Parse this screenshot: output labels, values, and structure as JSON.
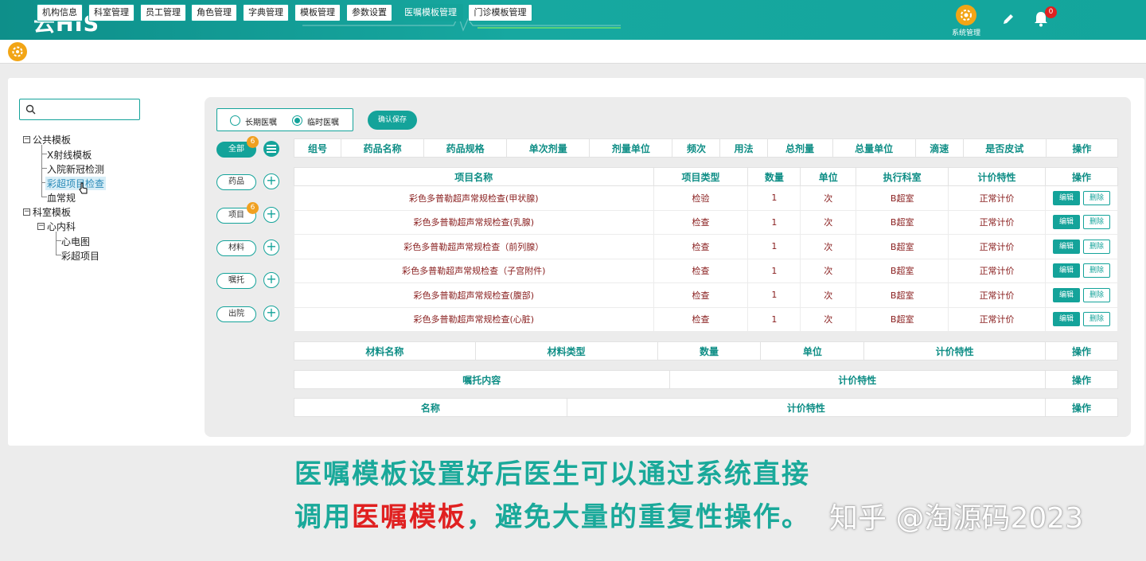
{
  "header": {
    "app_name": "云HIS",
    "system_label": "系统管理",
    "notification_count": "0"
  },
  "tabs": [
    {
      "label": "机构信息",
      "active": false
    },
    {
      "label": "科室管理",
      "active": false
    },
    {
      "label": "员工管理",
      "active": false
    },
    {
      "label": "角色管理",
      "active": false
    },
    {
      "label": "字典管理",
      "active": false
    },
    {
      "label": "模板管理",
      "active": false
    },
    {
      "label": "参数设置",
      "active": false
    },
    {
      "label": "医嘱模板管理",
      "active": true
    },
    {
      "label": "门诊模板管理",
      "active": false
    }
  ],
  "search": {
    "placeholder": ""
  },
  "tree": {
    "public": "公共模板",
    "public_items": [
      "X射线模板",
      "入院新冠检测",
      "彩超项目检查",
      "血常规"
    ],
    "dept": "科室模板",
    "dept_child": "心内科",
    "dept_items": [
      "心电图",
      "彩超项目"
    ]
  },
  "order_type": {
    "long": "长期医嘱",
    "temp": "临时医嘱",
    "selected": "temp"
  },
  "save_label": "确认保存",
  "categories": [
    {
      "label": "全部",
      "count": "6"
    },
    {
      "label": "药品",
      "count": ""
    },
    {
      "label": "项目",
      "count": "6"
    },
    {
      "label": "材料",
      "count": ""
    },
    {
      "label": "嘱托",
      "count": ""
    },
    {
      "label": "出院",
      "count": ""
    }
  ],
  "drug_table": {
    "headers": [
      "组号",
      "药品名称",
      "药品规格",
      "单次剂量",
      "剂量单位",
      "频次",
      "用法",
      "总剂量",
      "总量单位",
      "滴速",
      "是否皮试",
      "操作"
    ]
  },
  "item_table": {
    "headers": [
      "项目名称",
      "项目类型",
      "数量",
      "单位",
      "执行科室",
      "计价特性",
      "操作"
    ],
    "rows": [
      [
        "彩色多普勒超声常规检查(甲状腺)",
        "检验",
        "1",
        "次",
        "B超室",
        "正常计价"
      ],
      [
        "彩色多普勒超声常规检查(乳腺)",
        "检查",
        "1",
        "次",
        "B超室",
        "正常计价"
      ],
      [
        "彩色多普勒超声常规检查（前列腺）",
        "检查",
        "1",
        "次",
        "B超室",
        "正常计价"
      ],
      [
        "彩色多普勒超声常规检查（子宫附件)",
        "检查",
        "1",
        "次",
        "B超室",
        "正常计价"
      ],
      [
        "彩色多普勒超声常规检查(腹部)",
        "检查",
        "1",
        "次",
        "B超室",
        "正常计价"
      ],
      [
        "彩色多普勒超声常规检查(心脏)",
        "检查",
        "1",
        "次",
        "B超室",
        "正常计价"
      ]
    ],
    "edit_label": "编辑",
    "delete_label": "删除"
  },
  "material_table": {
    "headers": [
      "材料名称",
      "材料类型",
      "数量",
      "单位",
      "计价特性",
      "操作"
    ]
  },
  "entrust_table": {
    "headers": [
      "嘱托内容",
      "计价特性",
      "操作"
    ]
  },
  "discharge_table": {
    "headers": [
      "名称",
      "计价特性",
      "操作"
    ]
  },
  "caption": {
    "line1": "医嘱模板设置好后医生可以通过系统直接",
    "line2_a": "调用",
    "line2_b": "医嘱模板",
    "line2_c": "，避免大量的重复性操作。"
  },
  "watermark": "知乎 @淘源码2023",
  "colors": {
    "primary": "#14a39a",
    "accent": "#f2a516",
    "text_red": "#8a2020",
    "caption_green": "#1aa99a",
    "caption_red": "#e02020"
  }
}
